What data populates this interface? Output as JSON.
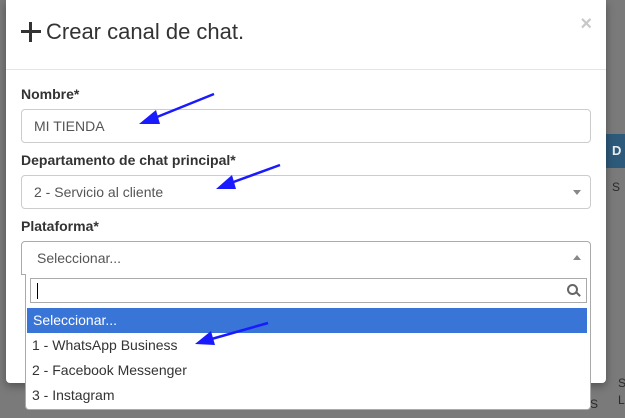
{
  "background": {
    "header_cell": "D",
    "cell_1": "S",
    "cell_2": "S",
    "cell_3": "L",
    "cell_4": "S"
  },
  "modal": {
    "title": "Crear canal de chat.",
    "close_symbol": "×"
  },
  "form": {
    "nombre": {
      "label": "Nombre*",
      "value": "MI TIENDA"
    },
    "departamento": {
      "label": "Departamento de chat principal*",
      "value": "2 - Servicio al cliente"
    },
    "plataforma": {
      "label": "Plataforma*",
      "value": "Seleccionar...",
      "search_value": "",
      "options": [
        "Seleccionar...",
        "1 - WhatsApp Business",
        "2 - Facebook Messenger",
        "3 - Instagram"
      ],
      "highlighted_index": 0
    }
  },
  "colors": {
    "highlight": "#3875d7",
    "annotation_arrow": "#1a1aff",
    "header_cell_bg": "#2d5a7b"
  },
  "icons": [
    "plus-icon",
    "close-icon",
    "chevron-down-icon",
    "chevron-up-icon",
    "search-icon",
    "arrow-annotation-icon"
  ]
}
